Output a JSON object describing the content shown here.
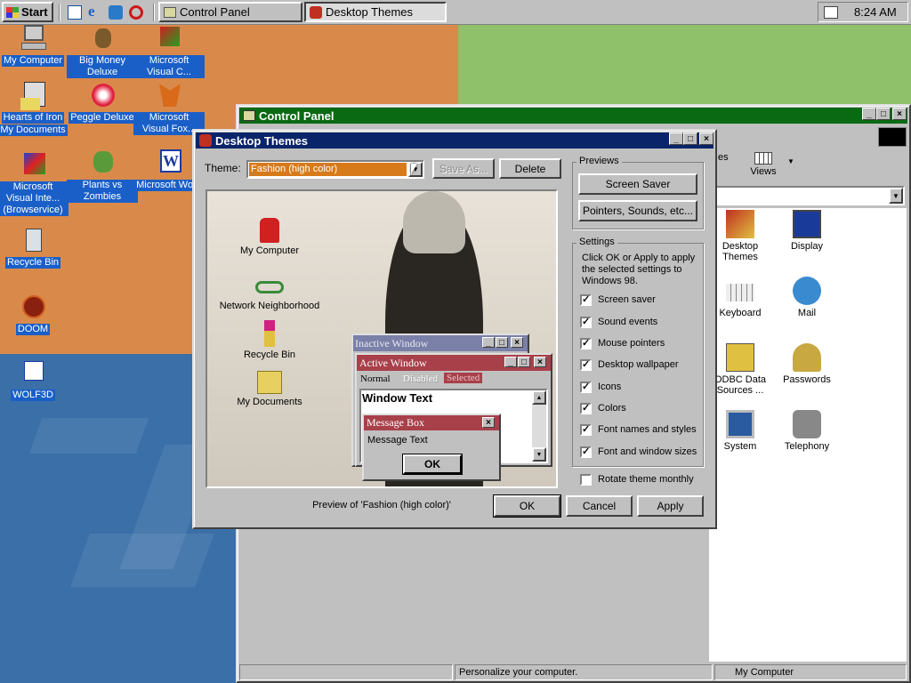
{
  "taskbar": {
    "start_label": "Start",
    "tasks": [
      "Control Panel",
      "Desktop Themes"
    ],
    "clock": "8:24 AM"
  },
  "desktop_icons": [
    {
      "label": "My Computer"
    },
    {
      "label": "Big Money Deluxe"
    },
    {
      "label": "Microsoft Visual C..."
    },
    {
      "label": "Hearts of Iron"
    },
    {
      "label": "My Documents"
    },
    {
      "label": "Peggle Deluxe"
    },
    {
      "label": "Microsoft Visual Fox..."
    },
    {
      "label": "Microsoft Visual Inte... (Browservice)"
    },
    {
      "label": "Plants vs Zombies"
    },
    {
      "label": "Microsoft Word"
    },
    {
      "label": "Recycle Bin"
    },
    {
      "label": "DOOM"
    },
    {
      "label": "WOLF3D"
    }
  ],
  "control_panel": {
    "title": "Control Panel",
    "toolbar_views": "Views",
    "toolbar_partial": "es",
    "icons": [
      {
        "label": "Desktop Themes"
      },
      {
        "label": "Display"
      },
      {
        "label": "Keyboard"
      },
      {
        "label": "Mail"
      },
      {
        "label": "ODBC Data Sources ..."
      },
      {
        "label": "Passwords"
      },
      {
        "label": "System"
      },
      {
        "label": "Telephony"
      }
    ],
    "status_text": "Personalize your computer.",
    "status_zone": "My Computer"
  },
  "themes": {
    "title": "Desktop Themes",
    "theme_label": "Theme:",
    "theme_value": "Fashion (high color)",
    "save_as": "Save As...",
    "delete": "Delete",
    "previews_label": "Previews",
    "screen_saver": "Screen Saver",
    "pointers": "Pointers, Sounds, etc...",
    "settings_label": "Settings",
    "settings_hint": "Click OK or Apply to apply the selected settings to Windows 98.",
    "checks": [
      {
        "label": "Screen saver",
        "checked": true
      },
      {
        "label": "Sound events",
        "checked": true
      },
      {
        "label": "Mouse pointers",
        "checked": true
      },
      {
        "label": "Desktop wallpaper",
        "checked": true
      },
      {
        "label": "Icons",
        "checked": true
      },
      {
        "label": "Colors",
        "checked": true
      },
      {
        "label": "Font names and styles",
        "checked": true
      },
      {
        "label": "Font and window sizes",
        "checked": true
      }
    ],
    "rotate": "Rotate theme monthly",
    "preview_caption": "Preview of 'Fashion (high color)'",
    "ok": "OK",
    "cancel": "Cancel",
    "apply": "Apply",
    "preview": {
      "icons": [
        "My Computer",
        "Network Neighborhood",
        "Recycle Bin",
        "My Documents"
      ],
      "inactive_title": "Inactive Window",
      "active_title": "Active Window",
      "menu_normal": "Normal",
      "menu_disabled": "Disabled",
      "menu_selected": "Selected",
      "window_text": "Window Text",
      "msgbox_title": "Message Box",
      "msgbox_text": "Message Text",
      "msgbox_ok": "OK"
    }
  },
  "colors": {
    "title_active": "#0a246a",
    "title_cp": "#0a6a14",
    "selection": "#1a5fc8",
    "theme_active_title": "#a8404a",
    "theme_inactive_title": "#7a80a8",
    "dropdown_value_bg": "#d77a1a"
  }
}
